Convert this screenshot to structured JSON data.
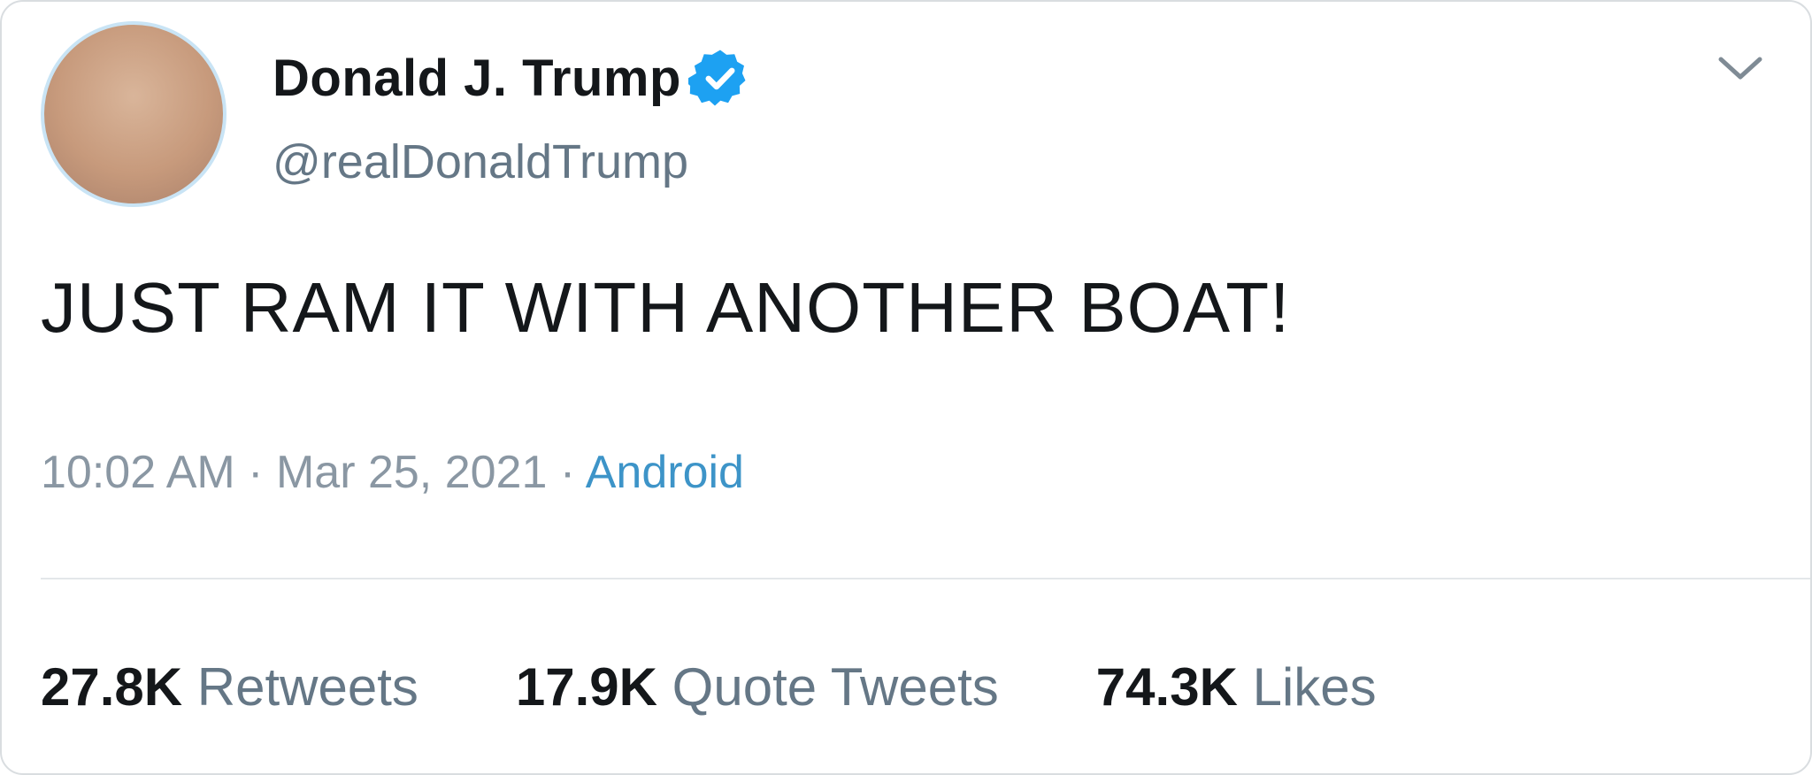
{
  "tweet": {
    "author": {
      "display_name": "Donald J. Trump",
      "handle": "@realDonaldTrump",
      "verified": true,
      "avatar": "profile-photo"
    },
    "text": "JUST RAM IT WITH ANOTHER BOAT!",
    "meta": {
      "time": "10:02 AM",
      "separator": "·",
      "date": "Mar 25, 2021",
      "source": "Android"
    },
    "stats": [
      {
        "count": "27.8K",
        "label": "Retweets"
      },
      {
        "count": "17.9K",
        "label": "Quote Tweets"
      },
      {
        "count": "74.3K",
        "label": "Likes"
      }
    ],
    "menu_icon": "chevron-down-icon"
  },
  "colors": {
    "text_primary": "#14171a",
    "text_secondary": "#657786",
    "link": "#3d94c8",
    "verified": "#1da1f2",
    "divider": "#e3e7ea"
  }
}
